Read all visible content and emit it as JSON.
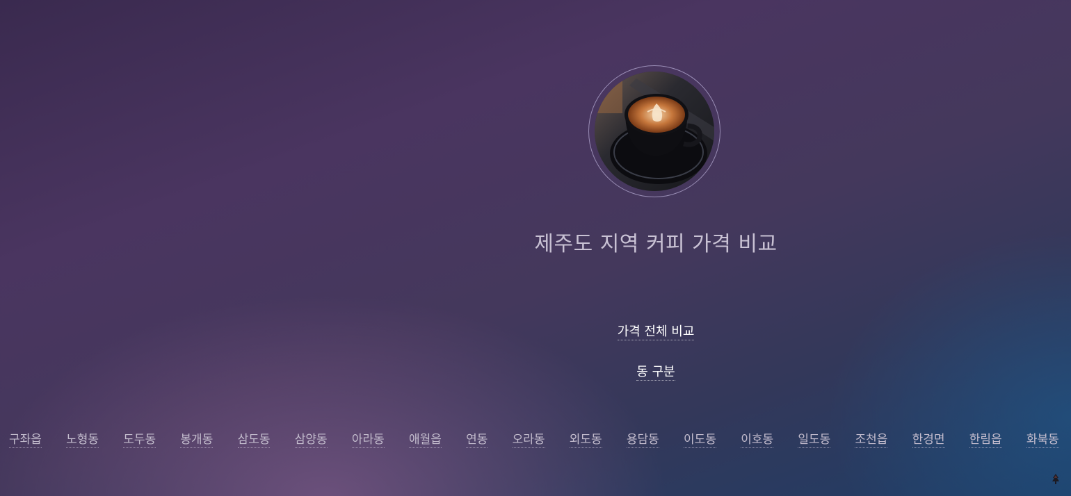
{
  "hero": {
    "image_icon": "coffee-cup-latte-art-photo",
    "title": "제주도 지역 커피 가격 비교"
  },
  "nav": {
    "price_compare": "가격 전체 비교",
    "dong_division": "동 구분"
  },
  "regions": [
    "구좌읍",
    "노형동",
    "도두동",
    "봉개동",
    "삼도동",
    "삼양동",
    "아라동",
    "애월읍",
    "연동",
    "오라동",
    "외도동",
    "용담동",
    "이도동",
    "이호동",
    "일도동",
    "조천읍",
    "한경면",
    "한림읍",
    "화북동"
  ],
  "corner_icon": "small-tree-icon"
}
